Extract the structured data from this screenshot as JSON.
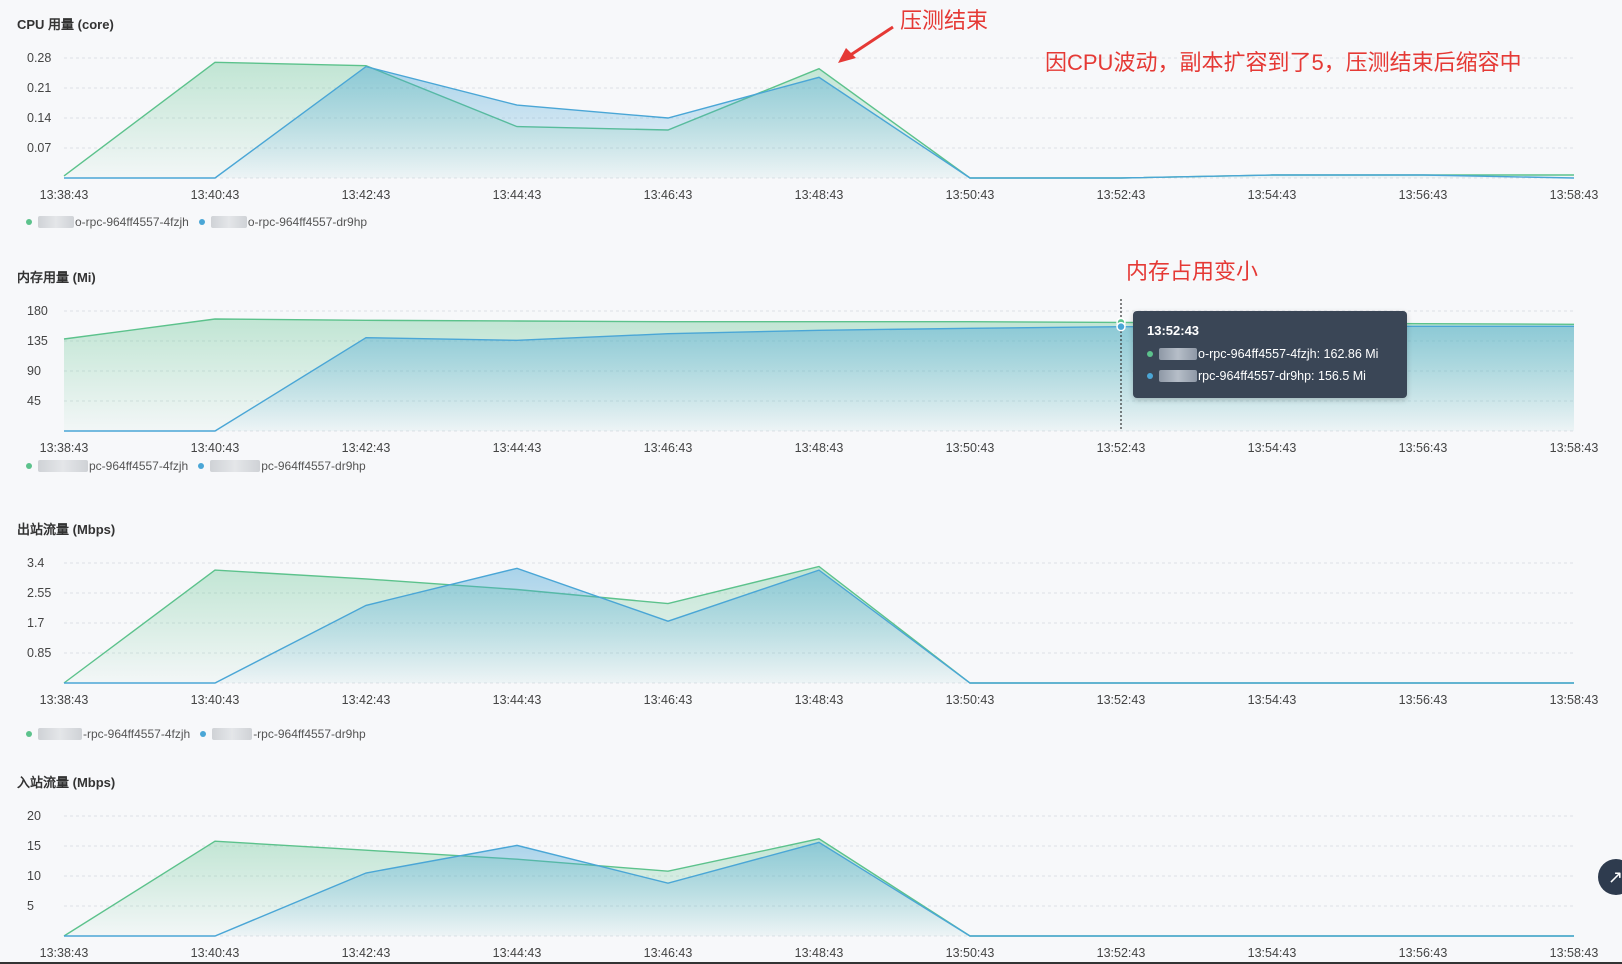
{
  "series_colors": {
    "green": "#5cc28c",
    "blue": "#4aa6d6"
  },
  "x_labels": [
    "13:38:43",
    "13:40:43",
    "13:42:43",
    "13:44:43",
    "13:46:43",
    "13:48:43",
    "13:50:43",
    "13:52:43",
    "13:54:43",
    "13:56:43",
    "13:58:43"
  ],
  "legend_suffixes": {
    "cpu": [
      "o-rpc-964ff4557-4fzjh",
      "o-rpc-964ff4557-dr9hp"
    ],
    "mem": [
      "pc-964ff4557-4fzjh",
      "pc-964ff4557-dr9hp"
    ],
    "out": [
      "-rpc-964ff4557-4fzjh",
      "-rpc-964ff4557-dr9hp"
    ],
    "in": []
  },
  "annotations": {
    "stress_end": "压测结束",
    "scaling_note": "因CPU波动，副本扩容到了5，压测结束后缩容中",
    "memory_note": "内存占用变小"
  },
  "tooltip": {
    "time": "13:52:43",
    "rows": [
      {
        "name": "o-rpc-964ff4557-4fzjh",
        "value": "162.86 Mi"
      },
      {
        "name": "rpc-964ff4557-dr9hp",
        "value": "156.5 Mi"
      }
    ]
  },
  "chart_data": [
    {
      "key": "cpu",
      "type": "area",
      "title": "CPU 用量 (core)",
      "y_ticks": [
        "0.28",
        "0.21",
        "0.14",
        "0.07"
      ],
      "ylim": [
        0,
        0.31
      ],
      "grid": true,
      "x": [
        "13:38:43",
        "13:40:43",
        "13:42:43",
        "13:44:43",
        "13:46:43",
        "13:48:43",
        "13:50:43",
        "13:52:43",
        "13:54:43",
        "13:56:43",
        "13:58:43"
      ],
      "series": [
        {
          "values": [
            0.005,
            0.27,
            0.262,
            0.12,
            0.112,
            0.255,
            0.0,
            0.0,
            0.007,
            0.007,
            0.007
          ]
        },
        {
          "values": [
            0.0,
            0.0,
            0.26,
            0.17,
            0.14,
            0.235,
            0.0,
            0.0,
            0.007,
            0.007,
            0.0
          ]
        }
      ]
    },
    {
      "key": "mem",
      "type": "area",
      "title": "内存用量 (Mi)",
      "y_ticks": [
        "180",
        "135",
        "90",
        "45"
      ],
      "ylim": [
        0,
        180
      ],
      "grid": true,
      "x": [
        "13:38:43",
        "13:40:43",
        "13:42:43",
        "13:44:43",
        "13:46:43",
        "13:48:43",
        "13:50:43",
        "13:52:43",
        "13:54:43",
        "13:56:43",
        "13:58:43"
      ],
      "series": [
        {
          "values": [
            138,
            168,
            166,
            165,
            164,
            164,
            164,
            162.86,
            162,
            161,
            160
          ]
        },
        {
          "values": [
            0,
            0,
            140,
            136,
            146,
            151,
            154,
            156.5,
            157,
            157,
            157
          ]
        }
      ]
    },
    {
      "key": "out",
      "type": "area",
      "title": "出站流量 (Mbps)",
      "y_ticks": [
        "3.4",
        "2.55",
        "1.7",
        "0.85"
      ],
      "ylim": [
        0,
        3.4
      ],
      "grid": true,
      "x": [
        "13:38:43",
        "13:40:43",
        "13:42:43",
        "13:44:43",
        "13:46:43",
        "13:48:43",
        "13:50:43",
        "13:52:43",
        "13:54:43",
        "13:56:43",
        "13:58:43"
      ],
      "series": [
        {
          "values": [
            0,
            3.2,
            2.95,
            2.65,
            2.25,
            3.3,
            0,
            0,
            0,
            0,
            0
          ]
        },
        {
          "values": [
            0,
            0,
            2.2,
            3.25,
            1.75,
            3.2,
            0,
            0,
            0,
            0,
            0
          ]
        }
      ]
    },
    {
      "key": "in",
      "type": "area",
      "title": "入站流量 (Mbps)",
      "y_ticks": [
        "20",
        "15",
        "10",
        "5"
      ],
      "ylim": [
        0,
        20
      ],
      "grid": true,
      "x": [
        "13:38:43",
        "13:40:43",
        "13:42:43",
        "13:44:43",
        "13:46:43",
        "13:48:43",
        "13:50:43",
        "13:52:43",
        "13:54:43",
        "13:56:43",
        "13:58:43"
      ],
      "series": [
        {
          "values": [
            0,
            15.8,
            14.3,
            12.8,
            10.8,
            16.2,
            0,
            0,
            0,
            0,
            0
          ]
        },
        {
          "values": [
            0,
            0,
            10.5,
            15.1,
            8.8,
            15.6,
            0,
            0,
            0,
            0,
            0
          ]
        }
      ]
    }
  ]
}
